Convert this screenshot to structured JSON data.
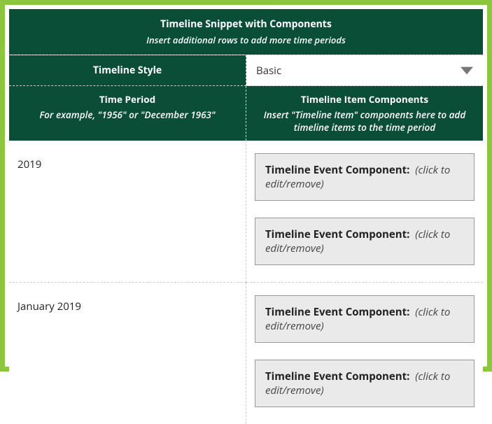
{
  "header": {
    "title": "Timeline Snippet with Components",
    "subtitle": "Insert additional rows to add more time periods"
  },
  "style_row": {
    "label": "Timeline Style",
    "selected": "Basic"
  },
  "columns": {
    "period": {
      "title": "Time Period",
      "hint": "For example, \"1956\" or \"December 1963\""
    },
    "items": {
      "title": "Timeline Item Components",
      "hint": "Insert \"Timeline Item\" components here to add timeline items to the time period"
    }
  },
  "event_template": {
    "label": "Timeline Event Component:",
    "hint": "(click to edit/remove)"
  },
  "rows": [
    {
      "period": "2019",
      "events": 2
    },
    {
      "period": "January 2019",
      "events": 2
    }
  ],
  "colors": {
    "frame": "#8CC63F",
    "header_bg": "#0A4E38",
    "event_bg": "#EAEAEA"
  }
}
